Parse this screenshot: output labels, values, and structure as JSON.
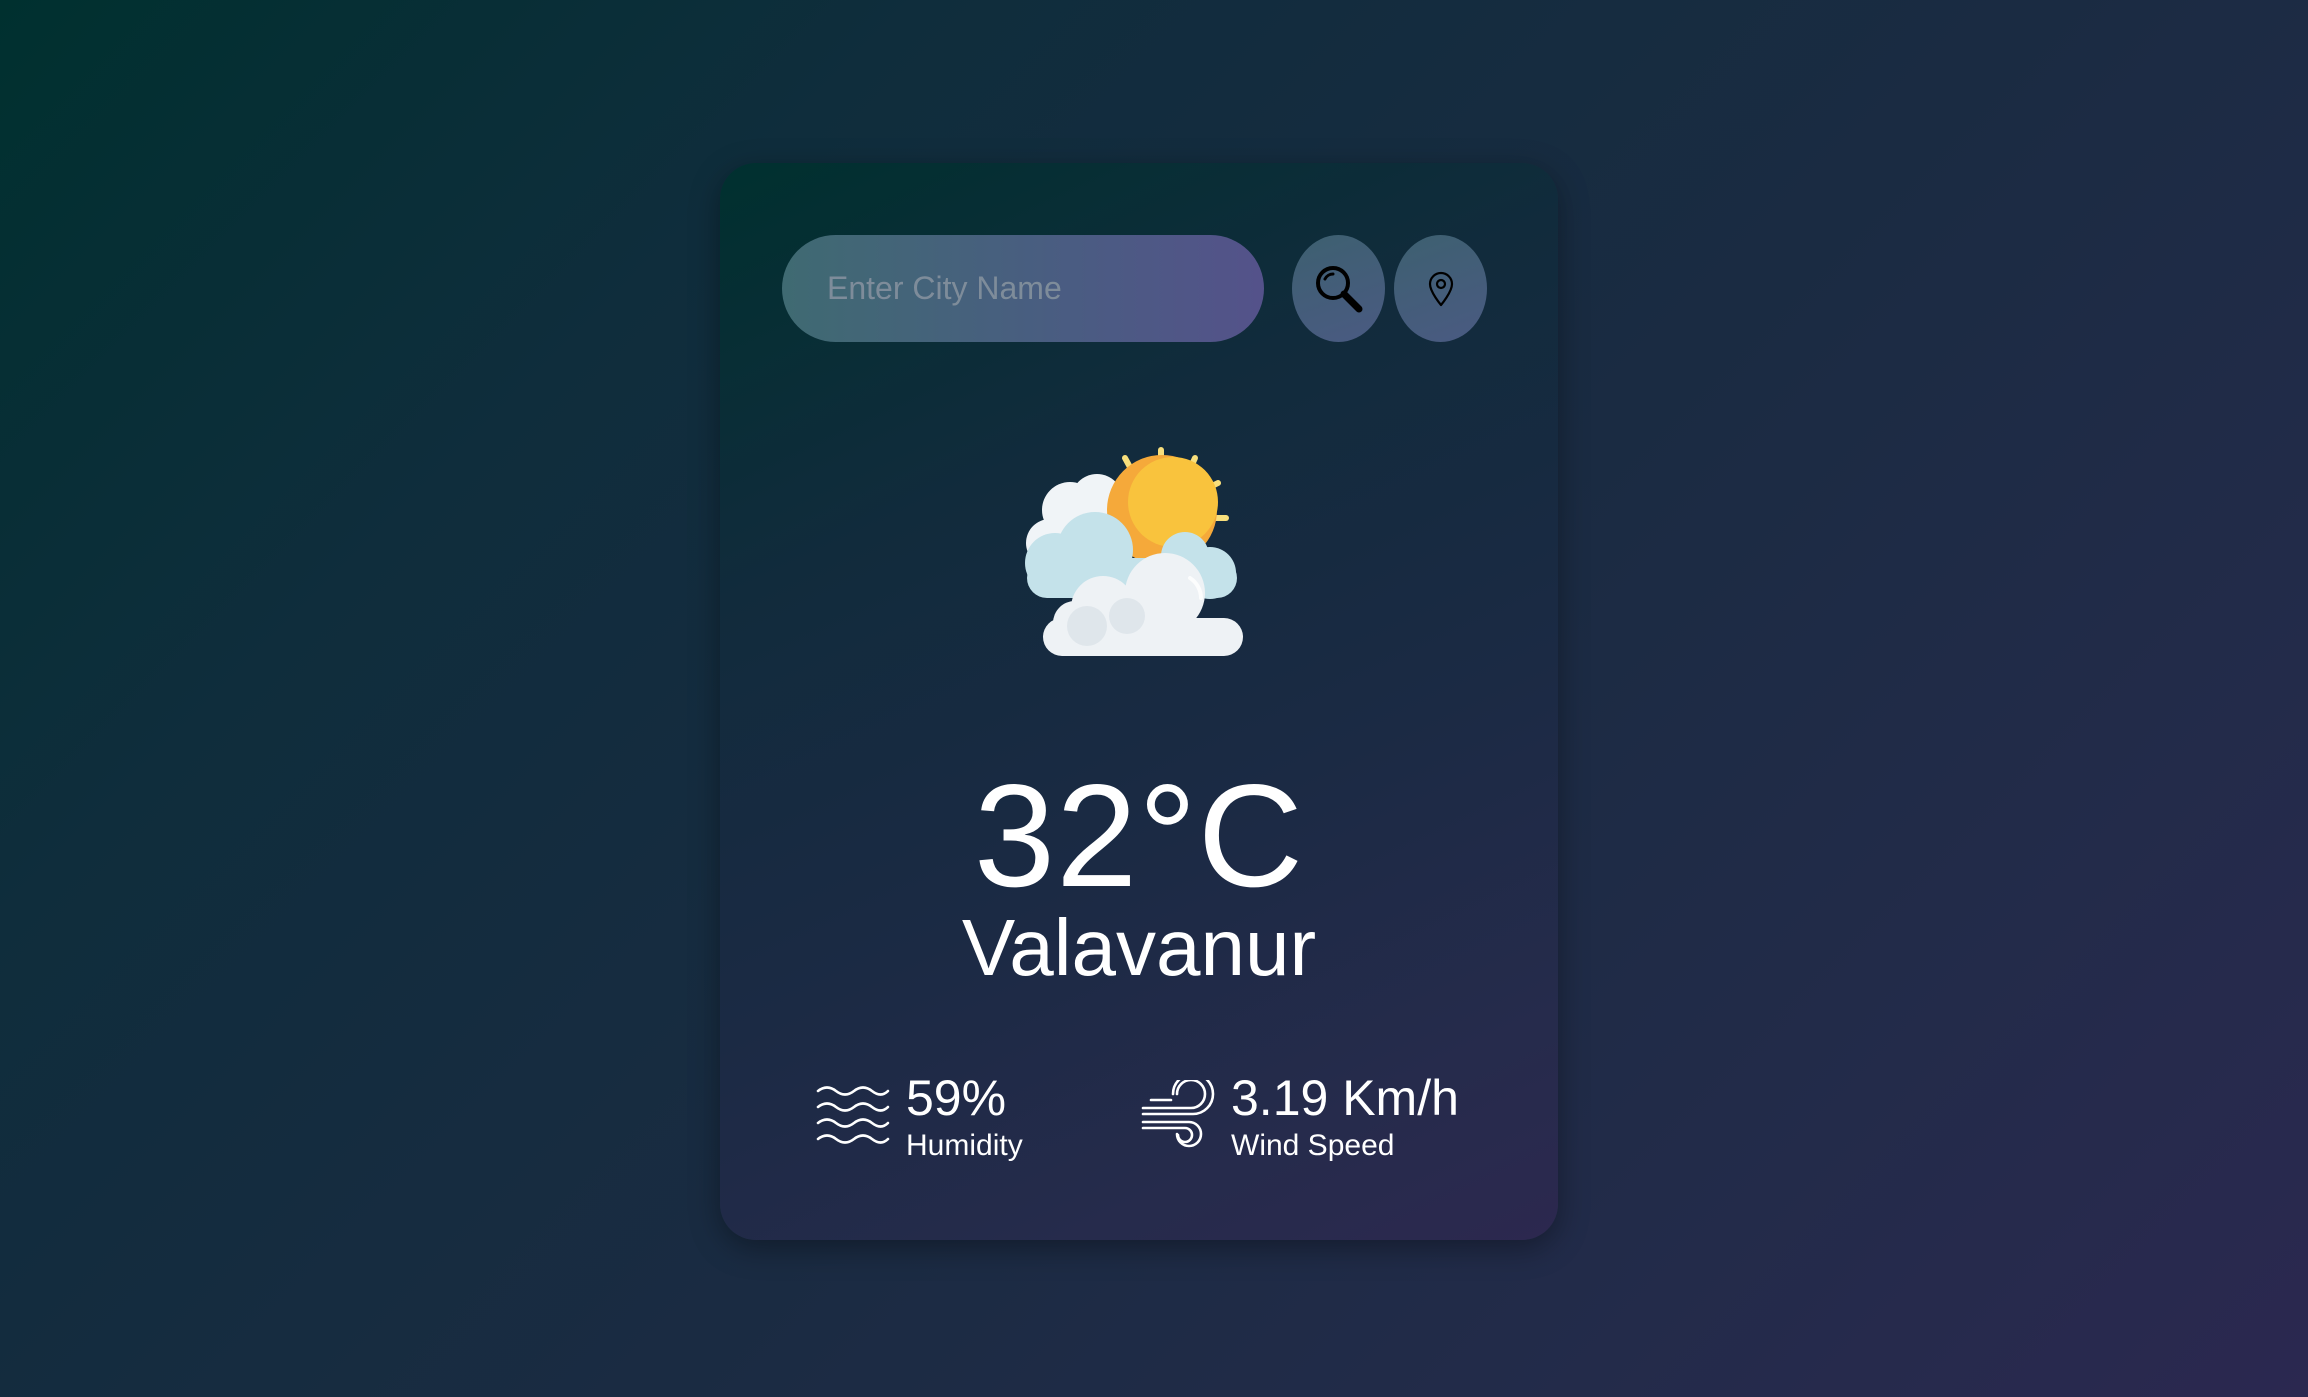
{
  "search": {
    "placeholder": "Enter City Name",
    "value": ""
  },
  "buttons": {
    "search_icon": "magnifier-icon",
    "location_icon": "location-pin-icon"
  },
  "weather": {
    "icon": "partly-cloudy-icon",
    "temperature": "32°C",
    "city": "Valavanur"
  },
  "stats": {
    "humidity": {
      "value": "59%",
      "label": "Humidity",
      "icon": "humidity-waves-icon"
    },
    "wind": {
      "value": "3.19 Km/h",
      "label": "Wind Speed",
      "icon": "wind-icon"
    }
  },
  "colors": {
    "text": "#ffffff",
    "placeholder": "#7e8c9a",
    "sun": "#f9c33d",
    "cloud": "#eef2f5"
  }
}
